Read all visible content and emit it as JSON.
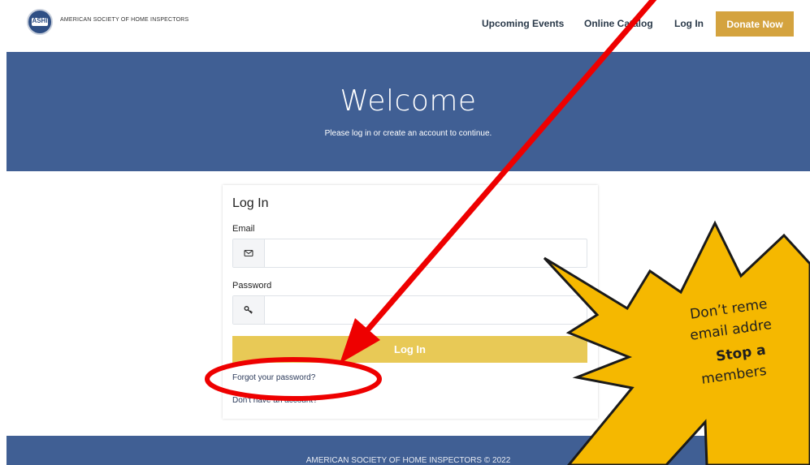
{
  "header": {
    "logo_seal_text": "ASHI",
    "logo_name": "AMERICAN SOCIETY OF HOME INSPECTORS",
    "nav": [
      "Upcoming Events",
      "Online Catalog",
      "Log In"
    ],
    "donate_label": "Donate Now"
  },
  "hero": {
    "title": "Welcome",
    "subtitle": "Please log in or create an account to continue."
  },
  "login": {
    "title": "Log In",
    "email_label": "Email",
    "email_value": "",
    "password_label": "Password",
    "password_value": "",
    "submit_label": "Log In",
    "forgot_link": "Forgot your password?",
    "signup_link": "Don't have an account?"
  },
  "footer": {
    "text": "AMERICAN SOCIETY OF HOME INSPECTORS © 2022"
  },
  "annotation": {
    "lines": [
      "Don’t reme",
      "email addre",
      "Stop a",
      "members"
    ],
    "star_color": "#f5b800",
    "arrow_color": "#ee0000"
  }
}
